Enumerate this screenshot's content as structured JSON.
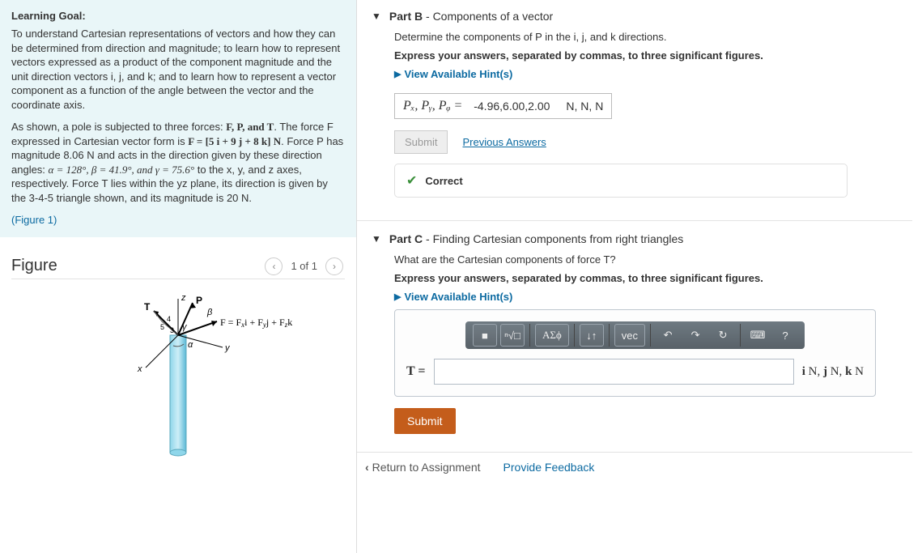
{
  "left": {
    "learning_goal_title": "Learning Goal:",
    "learning_goal_body": "To understand Cartesian representations of vectors and how they can be determined from direction and magnitude; to learn how to represent vectors expressed as a product of the component magnitude and the unit direction vectors i, j, and k; and to learn how to represent a vector component as a function of the angle between the vector and the coordinate axis.",
    "problem_text_pre": "As shown, a pole is subjected to three forces: ",
    "forces_list": "F, P, and T",
    "problem_text_mid": ". The force F expressed in Cartesian vector form is ",
    "force_f_expr": "F = [5 i + 9 j + 8 k] N",
    "problem_text_mid2": ". Force P has magnitude ",
    "p_mag": "8.06 N",
    "problem_text_mid3": " and acts in the direction given by these direction angles: ",
    "angles": "α = 128°, β = 41.9°, and γ = 75.6°",
    "problem_text_mid4": " to the x, y, and z axes, respectively. Force T lies within the yz plane, its direction is given by the 3-4-5 triangle shown, and its magnitude is ",
    "t_mag": "20 N",
    "figure_link": "(Figure 1)",
    "figure_title": "Figure",
    "figure_count": "1 of 1",
    "figure_formula": "F = Fₓi + Fᵧj + Fᵩk"
  },
  "partB": {
    "title_bold": "Part B",
    "title_rest": " - Components of a vector",
    "prompt": "Determine the components of P in the i, j, and k directions.",
    "instruction": "Express your answers, separated by commas, to three significant figures.",
    "hints": "View Available Hint(s)",
    "ans_label_prefix": "Pₓ, Pᵧ, Pᵩ =",
    "ans_value": "-4.96,6.00,2.00",
    "ans_units": "N, N, N",
    "submit": "Submit",
    "previous": "Previous Answers",
    "correct": "Correct"
  },
  "partC": {
    "title_bold": "Part C",
    "title_rest": " - Finding Cartesian components from right triangles",
    "prompt": "What are the Cartesian components of force T?",
    "instruction": "Express your answers, separated by commas, to three significant figures.",
    "hints": "View Available Hint(s)",
    "toolbar": {
      "templates": "■",
      "root": "ⁿ√□",
      "greek": "ΑΣϕ",
      "subsup": "↓↑",
      "vec": "vec",
      "undo": "↶",
      "redo": "↷",
      "reset": "↻",
      "keyboard": "⌨",
      "help": "?"
    },
    "ans_label": "T =",
    "ans_units": "i N, j N, k N",
    "submit": "Submit"
  },
  "footer": {
    "return": "Return to Assignment",
    "feedback": "Provide Feedback"
  }
}
